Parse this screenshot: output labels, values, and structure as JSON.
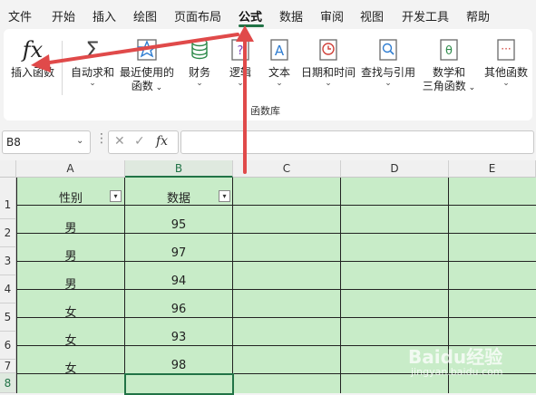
{
  "menubar": {
    "items": [
      "文件",
      "开始",
      "插入",
      "绘图",
      "页面布局",
      "公式",
      "数据",
      "审阅",
      "视图",
      "开发工具",
      "帮助"
    ],
    "active": "公式"
  },
  "ribbon": {
    "insert_function": "插入函数",
    "autosum": "自动求和",
    "recent_line1": "最近使用的",
    "recent_line2": "函数",
    "financial": "财务",
    "logical": "逻辑",
    "text": "文本",
    "datetime": "日期和时间",
    "lookup": "查找与引用",
    "math_line1": "数学和",
    "math_line2": "三角函数",
    "more": "其他函数",
    "group_label": "函数库"
  },
  "formula_bar": {
    "name_box": "B8",
    "fx_label": "fx",
    "formula": ""
  },
  "sheet": {
    "columns": [
      "A",
      "B",
      "C",
      "D",
      "E"
    ],
    "selected_column": "B",
    "row_numbers": [
      "1",
      "2",
      "3",
      "4",
      "5",
      "6",
      "7",
      "8"
    ],
    "header": {
      "a": "性别",
      "b": "数据"
    },
    "rows": [
      {
        "a": "男",
        "b": "95"
      },
      {
        "a": "男",
        "b": "97"
      },
      {
        "a": "男",
        "b": "94"
      },
      {
        "a": "女",
        "b": "96"
      },
      {
        "a": "女",
        "b": "93"
      },
      {
        "a": "女",
        "b": "98"
      }
    ],
    "selected_cell": "B8"
  },
  "watermark": {
    "text": "Baidu经验",
    "sub": "jingyan.baidu.com"
  },
  "colors": {
    "accent": "#217346",
    "cell_fill": "#c8ecc8",
    "arrow": "#e04a4a"
  }
}
